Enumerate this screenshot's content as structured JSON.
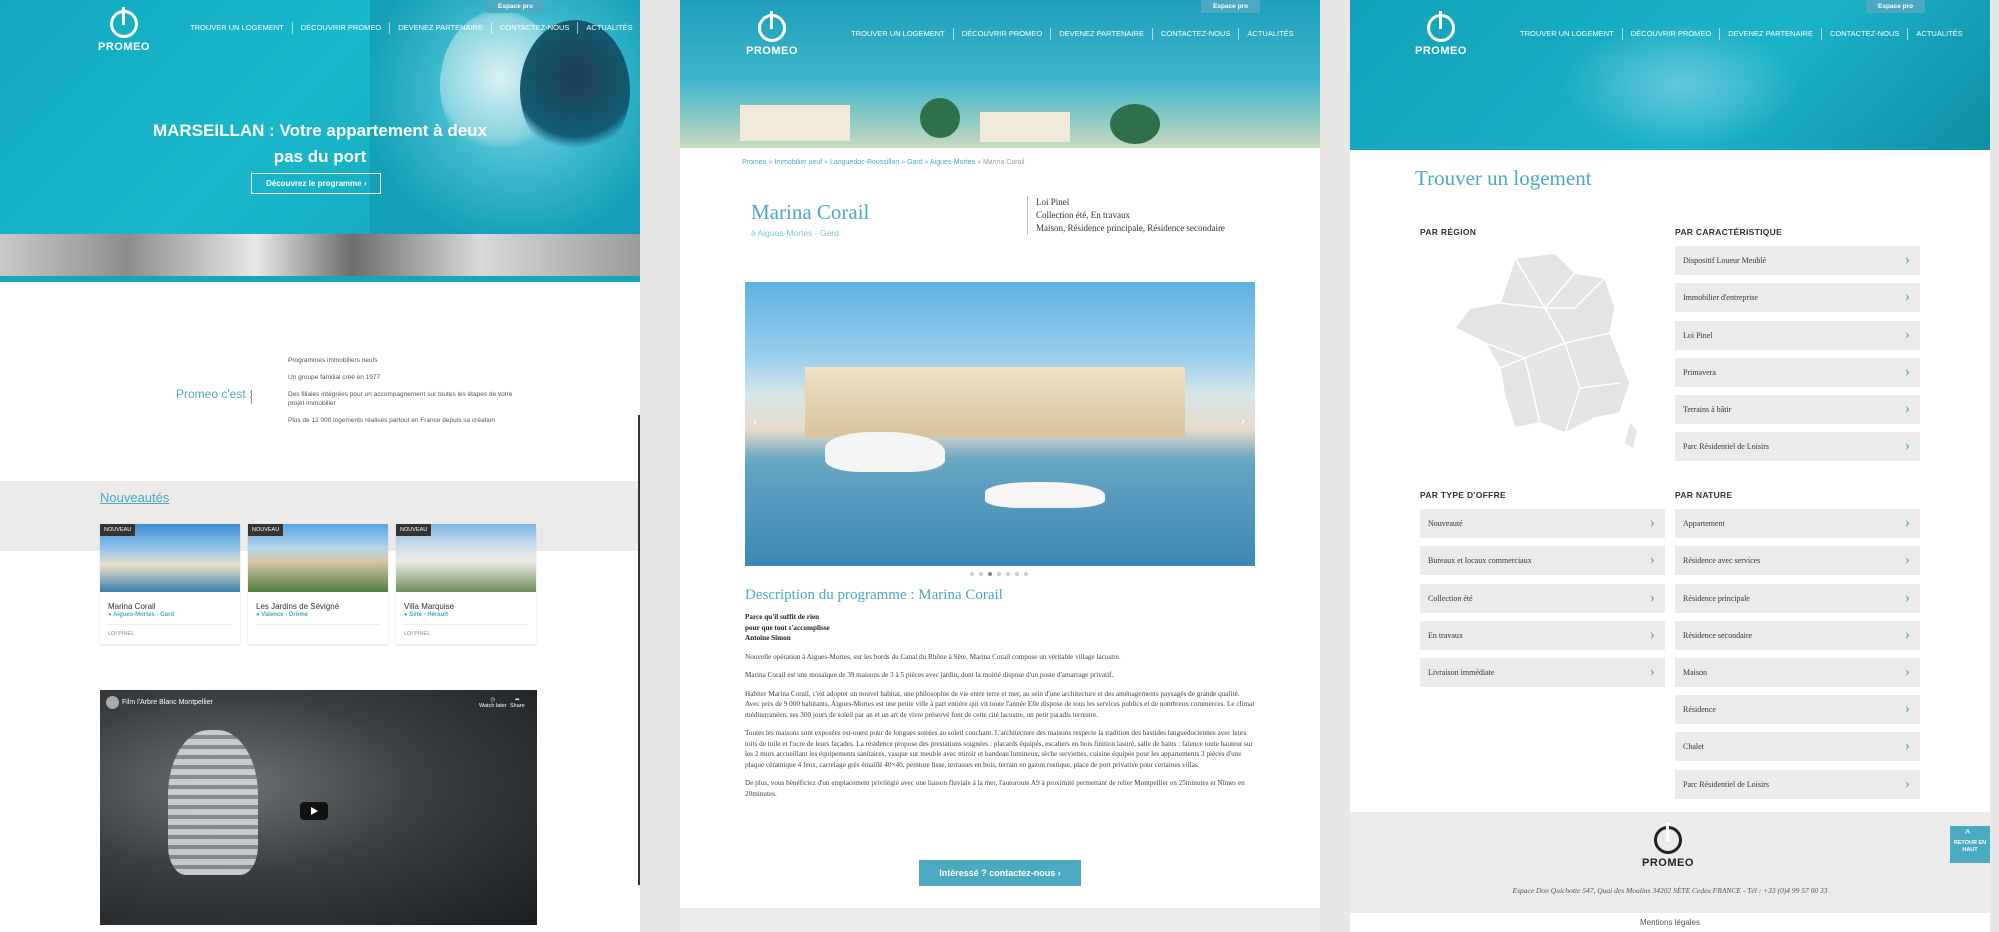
{
  "nav": {
    "items": [
      "TROUVER UN LOGEMENT",
      "DÉCOUVRIR PROMEO",
      "DEVENEZ PARTENAIRE",
      "CONTACTEZ-NOUS",
      "ACTUALITÉS"
    ],
    "espace_pro": "Espace pro"
  },
  "logo": "PROMEO",
  "home": {
    "hero_title": "MARSEILLAN : Votre appartement à deux pas du port",
    "hero_button": "Découvrez le programme",
    "promeo_cest": "Promeo c'est :",
    "about_lines": [
      "Programmes immobiliers neufs",
      "Un groupe familial créé en 1977",
      "Des filiales intégrées pour un accompagnement sur toutes les étapes de votre projet immobilier",
      "Plus de 12 000 logements réalisés partout en France depuis sa création"
    ],
    "nouveautes": "Nouveautés",
    "cards": [
      {
        "badge": "NOUVEAU",
        "name": "Marina Corail",
        "loc": "Aigues-Mortes - Gard",
        "tag": "LOI PINEL"
      },
      {
        "badge": "NOUVEAU",
        "name": "Les Jardins de Sévigné",
        "loc": "Valence - Drôme",
        "tag": ""
      },
      {
        "badge": "NOUVEAU",
        "name": "Villa Marquise",
        "loc": "Sète - Hérault",
        "tag": "LOI PINEL"
      }
    ],
    "video": {
      "title": "Film l'Arbre Blanc Montpellier",
      "watch_later": "Watch later",
      "share": "Share"
    }
  },
  "program": {
    "breadcrumb": [
      "Promeo",
      "Immobilier neuf",
      "Languedoc-Roussillon",
      "Gard",
      "Aigues-Mortes",
      "Marina Corail"
    ],
    "title": "Marina Corail",
    "location": "à Aigues-Mortes - Gard",
    "meta": [
      "Loi Pinel",
      "Collection été, En travaux",
      "Maison, Résidence principale, Résidence secondaire"
    ],
    "desc_title": "Description du programme : Marina Corail",
    "quote": [
      "Parce qu'il suffit de rien",
      "pour que tout s'accomplisse",
      "Antoine Simon"
    ],
    "paragraphs": [
      "Nouvelle opération à Aigues-Mortes, sur les bords du Canal du Rhône à Sète, Marina Corail compose un véritable village lacustre.",
      "Marina Corail est une mosaïque de 39 maisons de 3 à 5 pièces avec jardin, dont la moitié dispose d'un poste d'amarrage privatif.",
      "Habiter Marina Corail, c'est adopter un nouvel habitat, une philosophie de vie entre terre et mer, au sein d'une architecture et des aménagements paysagés de grande qualité. Avec près de 9 000 habitants, Aigues-Mortes est une petite ville à part entière qui vit toute l'année Elle dispose de tous les services publics et de nombreux commerces. Le climat méditerranéen, ses 300 jours de soleil par an et un art de vivre préservé font de cette cité lacustre, un petit paradis terrestre.",
      "Toutes les maisons sont exposées est-ouest pour de longues soirées au soleil couchant. L'architecture des maisons respecte la tradition des bastides languedociennes avec leurs toits de tuile et l'ocre de leurs façades. La résidence propose des prestations soignées : placards équipés, escaliers en bois finition lasuré, salle de bains : faïence toute hauteur sur les 2 murs accueillant les équipements sanitaires, vasque sur meuble avec miroir et bandeau lumineux, sèche serviettes, cuisine équipée pour les appartements 3 pièces d'une plaque céramique 4 feux, carrelage grès émaillé 40×40, peinture lisse, terrasses en bois, terrain en gazon rustique, place de port privative pour certaines villas.",
      "De plus, vous bénéficiez d'un emplacement privilégié avec une liaison fluviale à la mer, l'autoroute A9 à proximité permettant de relier Montpellier en 25minutes et Nîmes en 20minutes."
    ],
    "cta": "Intéressé ? contactez-nous"
  },
  "search": {
    "title": "Trouver un logement",
    "par_region": "PAR RÉGION",
    "par_caracteristique": "PAR CARACTÉRISTIQUE",
    "caracteristiques": [
      "Dispositif Loueur Meublé",
      "Immobilier d'entreprise",
      "Loi Pinel",
      "Primavera",
      "Terrains à bâtir",
      "Parc Résidentiel de Loisirs"
    ],
    "par_type": "PAR TYPE D'OFFRE",
    "types": [
      "Nouveauté",
      "Bureaux et locaux commerciaux",
      "Collection été",
      "En travaux",
      "Livraison immédiate"
    ],
    "par_nature": "PAR NATURE",
    "natures": [
      "Appartement",
      "Résidence avec services",
      "Résidence principale",
      "Résidence secondaire",
      "Maison",
      "Résidence",
      "Chalet",
      "Parc Résidentiel de Loisirs"
    ],
    "footer_address": "Espace Don Quichotte 547, Quai des Moulins 34202 SÈTE Cedex FRANCE - Tél : +33 (0)4 99 57 00 33",
    "mentions": "Mentions légales",
    "back_top": "RETOUR EN HAUT"
  },
  "colors": {
    "accent": "#4ba9c2",
    "hero_teal": "#15a6bc",
    "band_gray": "#edebea"
  }
}
